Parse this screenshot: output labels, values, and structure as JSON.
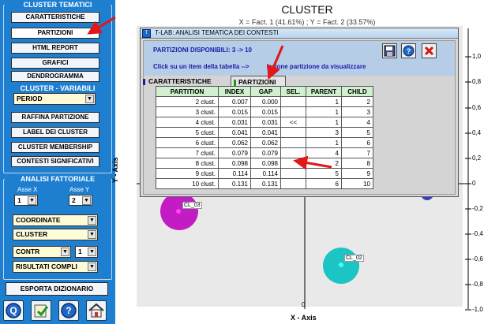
{
  "left_panel": {
    "cluster_tematici_title": "CLUSTER TEMATICI",
    "buttons": [
      "CARATTERISTICHE",
      "PARTIZIONI",
      "HTML REPORT",
      "GRAFICI",
      "DENDROGRAMMA"
    ],
    "cluster_variabili_title": "CLUSTER - VARIABILI",
    "variable_select": "PERIOD",
    "buttons2": [
      "RAFFINA PARTIZIONE",
      "LABEL DEI CLUSTER",
      "CLUSTER MEMBERSHIP",
      "CONTESTI SIGNIFICATIVI"
    ],
    "analisi_title": "ANALISI FATTORIALE",
    "asse_x_label": "Asse X",
    "asse_y_label": "Asse Y",
    "asse_x_value": "1",
    "asse_y_value": "2",
    "selects": [
      "COORDINATE",
      "CLUSTER"
    ],
    "contr_select": "CONTR",
    "contr_num": "1",
    "risultati_select": "RISULTATI COMPLI",
    "esporta_button": "ESPORTA DIZIONARIO",
    "bottom_icons": [
      "q-icon",
      "check-icon",
      "help-icon",
      "home-icon"
    ]
  },
  "plot": {
    "title": "CLUSTER",
    "subtitle": "X = Fact. 1 (41.61%) ; Y = Fact. 2 (33.57%)",
    "x_axis_label": "X - Axis",
    "y_axis_label": "Y - Axis",
    "y_ticks": [
      "1,0",
      "0,8",
      "0,6",
      "0,4",
      "0,2",
      "0",
      "-0,2",
      "-0,4",
      "-0,6",
      "-0,8",
      "-1,0"
    ],
    "x_ticks": [
      "0"
    ],
    "clusters": [
      {
        "label": "CL_03",
        "color": "#c41cc4"
      },
      {
        "label": "CL_02",
        "color": "#1cc4c4"
      }
    ]
  },
  "dialog": {
    "window_title": "T-LAB: ANALISI TEMATICA DEI CONTESTI",
    "info_line1": "PARTIZIONI DISPONIBILI: 3 -> 10",
    "info_line2_prefix": "Click su un item della tabella -->",
    "info_line2_suffix": "lezione partizione da visualizzare",
    "tab_caratteristiche": "CARATTERISTICHE",
    "tab_partizioni": "PARTIZIONI",
    "table": {
      "headers": [
        "PARTITION",
        "INDEX",
        "GAP",
        "SEL.",
        "PARENT",
        "CHILD"
      ],
      "rows": [
        [
          "2 clust.",
          "0.007",
          "0.000",
          "",
          "1",
          "2"
        ],
        [
          "3 clust.",
          "0.015",
          "0.015",
          "",
          "1",
          "3"
        ],
        [
          "4 clust.",
          "0.031",
          "0.031",
          "<<",
          "1",
          "4"
        ],
        [
          "5 clust.",
          "0.041",
          "0.041",
          "",
          "3",
          "5"
        ],
        [
          "6 clust.",
          "0.062",
          "0.062",
          "",
          "1",
          "6"
        ],
        [
          "7 clust.",
          "0.079",
          "0.079",
          "",
          "4",
          "7"
        ],
        [
          "8 clust.",
          "0.098",
          "0.098",
          "",
          "2",
          "8"
        ],
        [
          "9 clust.",
          "0.114",
          "0.114",
          "",
          "5",
          "9"
        ],
        [
          "10 clust.",
          "0.131",
          "0.131",
          "",
          "6",
          "10"
        ]
      ]
    }
  },
  "colors": {
    "left_panel_bg": "#1e7fd0",
    "annotation_arrow": "#e01818",
    "table_header_bg": "#d0f0d0",
    "dialog_text": "#1a1aa8"
  }
}
